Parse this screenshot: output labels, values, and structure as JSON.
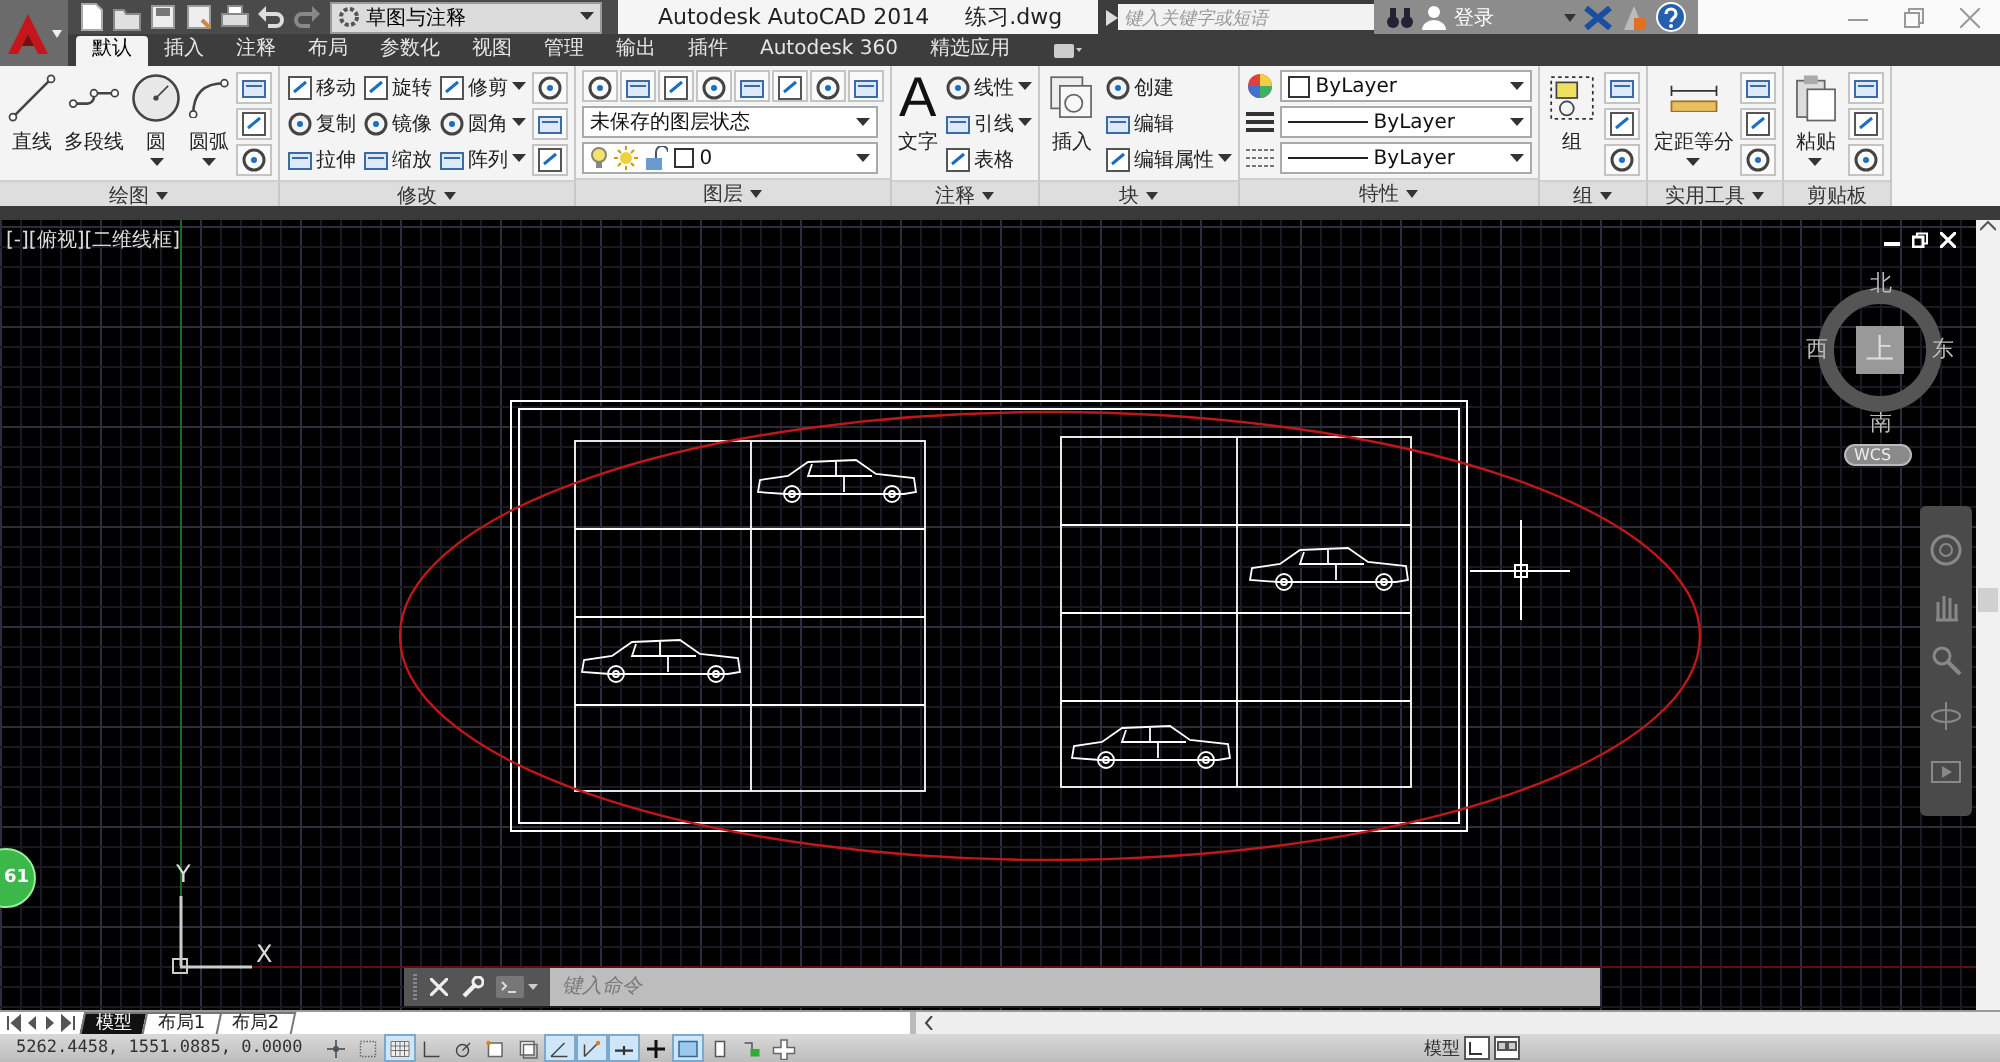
{
  "title_bar": {
    "workspace": "草图与注释",
    "title": "Autodesk AutoCAD 2014",
    "file": "练习.dwg",
    "search": {
      "placeholder": "键入关键字或短语"
    },
    "login": "登录"
  },
  "ribbon_tabs": [
    {
      "label": "默认",
      "selected": true
    },
    {
      "label": "插入",
      "selected": false
    },
    {
      "label": "注释",
      "selected": false
    },
    {
      "label": "布局",
      "selected": false
    },
    {
      "label": "参数化",
      "selected": false
    },
    {
      "label": "视图",
      "selected": false
    },
    {
      "label": "管理",
      "selected": false
    },
    {
      "label": "输出",
      "selected": false
    },
    {
      "label": "插件",
      "selected": false
    },
    {
      "label": "Autodesk 360",
      "selected": false
    },
    {
      "label": "精选应用",
      "selected": false
    }
  ],
  "ribbon_panels": [
    {
      "title": "绘图",
      "caret": true,
      "kind": "grid",
      "tools": [
        {
          "kind": "large",
          "label": "直线",
          "caret": false
        },
        {
          "kind": "large",
          "label": "多段线",
          "caret": false
        },
        {
          "kind": "large",
          "label": "圆",
          "caret": true
        },
        {
          "kind": "large",
          "label": "圆弧",
          "caret": true
        },
        {
          "kind": "icon"
        },
        {
          "kind": "icon"
        },
        {
          "kind": "icon"
        }
      ]
    },
    {
      "title": "修改",
      "caret": true,
      "kind": "grid",
      "tools": [
        {
          "kind": "small",
          "label": "移动",
          "caret": false
        },
        {
          "kind": "small",
          "label": "复制",
          "caret": false
        },
        {
          "kind": "small",
          "label": "拉伸",
          "caret": false
        },
        {
          "kind": "small",
          "label": "旋转",
          "caret": false
        },
        {
          "kind": "small",
          "label": "镜像",
          "caret": false
        },
        {
          "kind": "small",
          "label": "缩放",
          "caret": false
        },
        {
          "kind": "small",
          "label": "修剪",
          "caret": true
        },
        {
          "kind": "small",
          "label": "圆角",
          "caret": true
        },
        {
          "kind": "small",
          "label": "阵列",
          "caret": true
        },
        {
          "kind": "icon"
        },
        {
          "kind": "icon"
        },
        {
          "kind": "icon"
        }
      ]
    },
    {
      "title": "图层",
      "caret": true,
      "kind": "stack",
      "tools": [
        {
          "kind": "icon"
        },
        {
          "kind": "icon"
        },
        {
          "kind": "icon"
        },
        {
          "kind": "icon"
        },
        {
          "kind": "icon"
        },
        {
          "kind": "icon"
        },
        {
          "kind": "icon"
        },
        {
          "kind": "icon"
        },
        {
          "kind": "combo",
          "value": "未保存的图层状态"
        },
        {
          "kind": "layercombo",
          "value": "0"
        }
      ]
    },
    {
      "title": "注释",
      "caret": true,
      "kind": "grid",
      "tools": [
        {
          "kind": "large",
          "label": "文字",
          "glyph": "A",
          "caret": false
        },
        {
          "kind": "small",
          "label": "线性",
          "caret": true
        },
        {
          "kind": "small",
          "label": "引线",
          "caret": true
        },
        {
          "kind": "small",
          "label": "表格",
          "caret": false
        }
      ]
    },
    {
      "title": "块",
      "caret": true,
      "kind": "grid",
      "tools": [
        {
          "kind": "large",
          "label": "插入",
          "caret": false
        },
        {
          "kind": "small",
          "label": "创建",
          "caret": false
        },
        {
          "kind": "small",
          "label": "编辑",
          "caret": false
        },
        {
          "kind": "small",
          "label": "编辑属性",
          "caret": true
        }
      ]
    },
    {
      "title": "特性",
      "caret": true,
      "kind": "stack",
      "tools": [
        {
          "kind": "colorcombo",
          "value": "ByLayer"
        },
        {
          "kind": "weightcombo",
          "value": "ByLayer"
        },
        {
          "kind": "typecombo",
          "value": "ByLayer"
        }
      ]
    },
    {
      "title": "组",
      "caret": true,
      "kind": "grid",
      "tools": [
        {
          "kind": "large",
          "label": "组",
          "caret": false
        },
        {
          "kind": "icon"
        },
        {
          "kind": "icon"
        },
        {
          "kind": "icon"
        }
      ]
    },
    {
      "title": "实用工具",
      "caret": true,
      "kind": "grid",
      "tools": [
        {
          "kind": "large",
          "label": "定距等分",
          "caret": true
        },
        {
          "kind": "icon"
        },
        {
          "kind": "icon"
        },
        {
          "kind": "icon"
        }
      ]
    },
    {
      "title": "剪贴板",
      "caret": false,
      "kind": "grid",
      "tools": [
        {
          "kind": "large",
          "label": "粘贴",
          "caret": true
        },
        {
          "kind": "icon"
        },
        {
          "kind": "icon"
        },
        {
          "kind": "icon"
        }
      ]
    }
  ],
  "viewport": {
    "label": "[-][俯视][二维线框]",
    "viewcube": {
      "north": "北",
      "south": "南",
      "west": "西",
      "east": "东",
      "face": "上",
      "ucs": "WCS"
    },
    "ucs_icon": {
      "x": "X",
      "y": "Y"
    },
    "badge": "61",
    "command_line": {
      "placeholder": "键入命令"
    }
  },
  "layout_tabs": [
    {
      "label": "模型",
      "selected": true
    },
    {
      "label": "布局1",
      "selected": false
    },
    {
      "label": "布局2",
      "selected": false
    }
  ],
  "status_bar": {
    "coordinates": "5262.4458, 1551.0885, 0.0000",
    "toggles": [
      {
        "on": false
      },
      {
        "on": false
      },
      {
        "on": true
      },
      {
        "on": false
      },
      {
        "on": false
      },
      {
        "on": false
      },
      {
        "on": false
      },
      {
        "on": true
      },
      {
        "on": true
      },
      {
        "on": true
      },
      {
        "on": false
      },
      {
        "on": true
      },
      {
        "on": false
      },
      {
        "on": false
      },
      {
        "on": false
      }
    ],
    "space": "模型"
  }
}
